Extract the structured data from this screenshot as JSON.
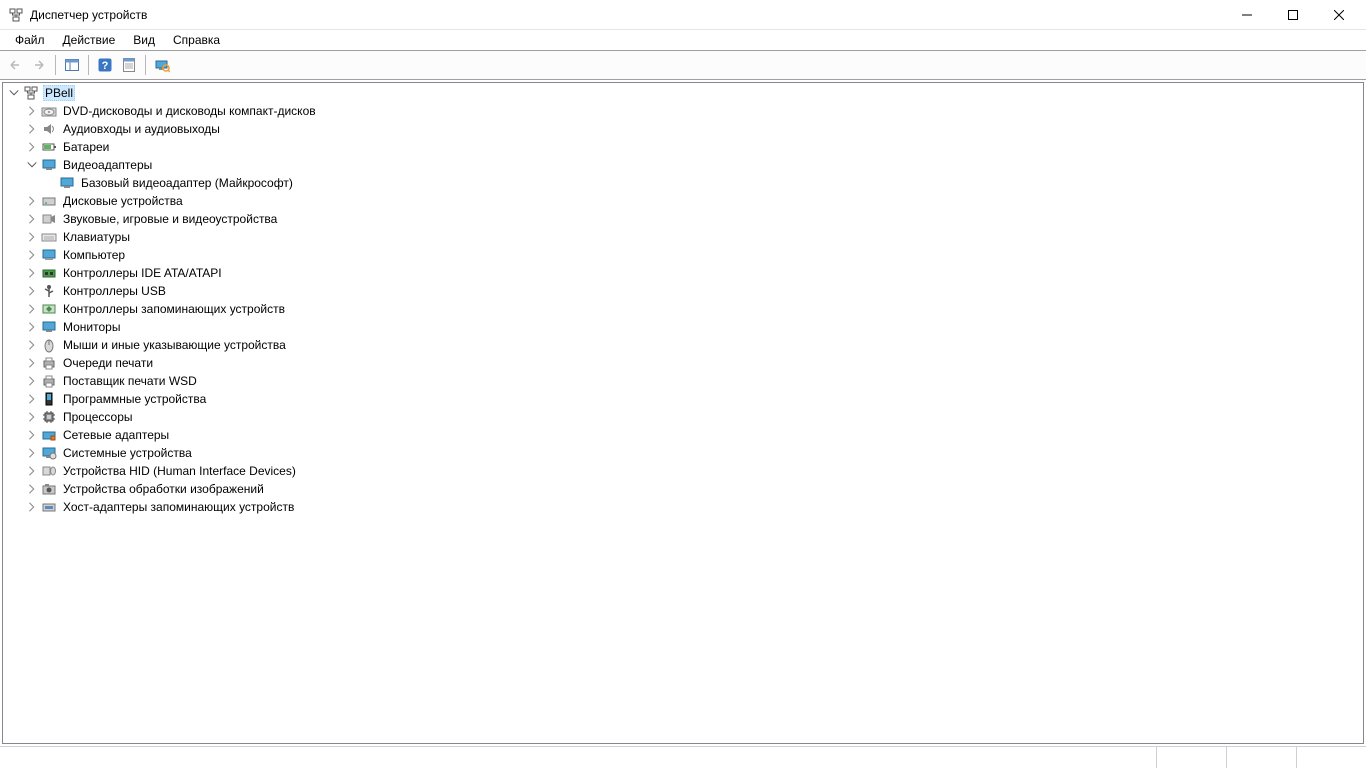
{
  "window": {
    "title": "Диспетчер устройств"
  },
  "menu": {
    "file": "Файл",
    "action": "Действие",
    "view": "Вид",
    "help": "Справка"
  },
  "tree": {
    "root": "PBell",
    "nodes": {
      "n0": "DVD-дисководы и дисководы компакт-дисков",
      "n1": "Аудиовходы и аудиовыходы",
      "n2": "Батареи",
      "n3": "Видеоадаптеры",
      "n3_0": "Базовый видеоадаптер (Майкрософт)",
      "n4": "Дисковые устройства",
      "n5": "Звуковые, игровые и видеоустройства",
      "n6": "Клавиатуры",
      "n7": "Компьютер",
      "n8": "Контроллеры IDE ATA/ATAPI",
      "n9": "Контроллеры USB",
      "n10": "Контроллеры запоминающих устройств",
      "n11": "Мониторы",
      "n12": "Мыши и иные указывающие устройства",
      "n13": "Очереди печати",
      "n14": "Поставщик печати WSD",
      "n15": "Программные устройства",
      "n16": "Процессоры",
      "n17": "Сетевые адаптеры",
      "n18": "Системные устройства",
      "n19": "Устройства HID (Human Interface Devices)",
      "n20": "Устройства обработки изображений",
      "n21": "Хост-адаптеры запоминающих устройств"
    }
  }
}
